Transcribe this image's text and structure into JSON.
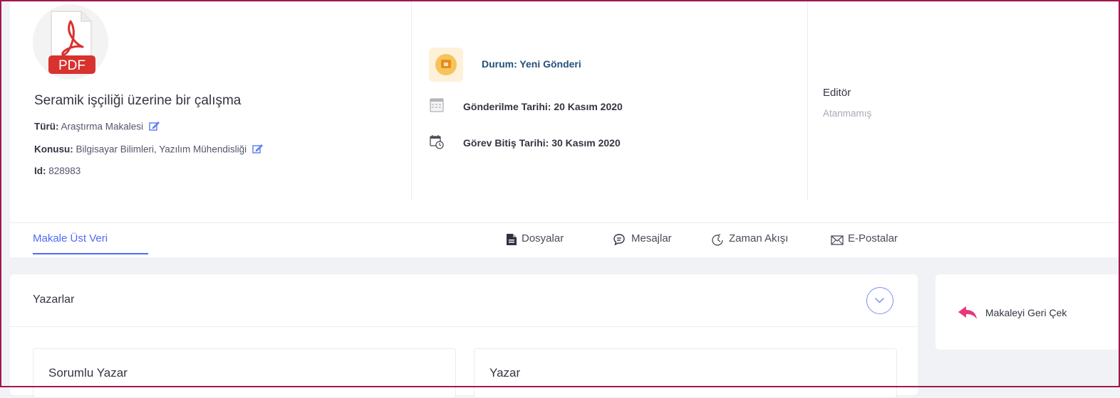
{
  "article": {
    "file_icon_label": "PDF",
    "title": "Seramik işçiliği üzerine bir çalışma",
    "type_label": "Türü:",
    "type_value": "Araştırma Makalesi",
    "subject_label": "Konusu:",
    "subject_value": "Bilgisayar Bilimleri, Yazılım Mühendisliği",
    "id_label": "Id:",
    "id_value": "828983"
  },
  "status": {
    "text": "Durum: Yeni Gönderi",
    "submitted": "Gönderilme Tarihi: 20 Kasım 2020",
    "due": "Görev Bitiş Tarihi: 30 Kasım 2020"
  },
  "editor": {
    "label": "Editör",
    "value": "Atanmamış"
  },
  "tabs": {
    "metadata": "Makale Üst Veri",
    "files": "Dosyalar",
    "messages": "Mesajlar",
    "timeline": "Zaman Akışı",
    "emails": "E-Postalar"
  },
  "authors": {
    "title": "Yazarlar",
    "corresponding": "Sorumlu Yazar",
    "author": "Yazar"
  },
  "actions": {
    "withdraw": "Makaleyi Geri Çek"
  },
  "colors": {
    "accent": "#4d6cf1",
    "status_blue": "#23507a",
    "pdf_red": "#d8322f",
    "withdraw_pink": "#e8377a",
    "frame": "#a2174f"
  }
}
